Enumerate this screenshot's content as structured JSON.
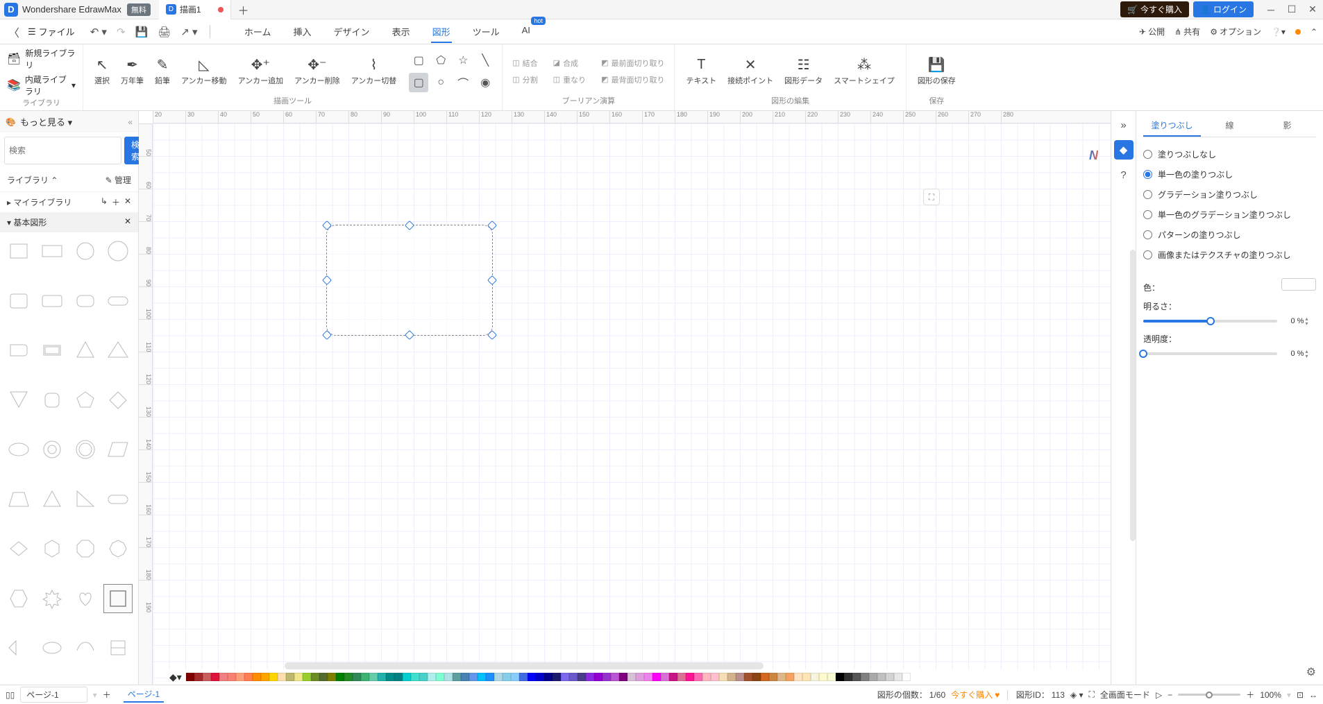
{
  "app": {
    "name": "Wondershare EdrawMax",
    "free_badge": "無料",
    "tab_title": "描画1"
  },
  "titlebar": {
    "buy_now": "今すぐ購入",
    "login": "ログイン"
  },
  "menubar": {
    "file": "ファイル",
    "tabs": [
      "ホーム",
      "挿入",
      "デザイン",
      "表示",
      "図形",
      "ツール",
      "AI"
    ],
    "active_tab": "図形",
    "hot": "hot",
    "publish": "公開",
    "share": "共有",
    "options": "オプション"
  },
  "ribbon": {
    "groups": {
      "library": {
        "label": "ライブラリ",
        "new": "新規ライブラリ",
        "builtin": "内蔵ライブラリ"
      },
      "drawing": {
        "label": "描画ツール",
        "select": "選択",
        "pen": "万年筆",
        "pencil": "鉛筆",
        "anchor_move": "アンカー移動",
        "anchor_add": "アンカー追加",
        "anchor_del": "アンカー削除",
        "anchor_cut": "アンカー切替"
      },
      "boolean": {
        "label": "ブーリアン演算",
        "combine": "結合",
        "compose": "合成",
        "front": "最前面切り取り",
        "split": "分割",
        "overlap": "重なり",
        "back": "最背面切り取り"
      },
      "edit": {
        "label": "図形の編集",
        "text": "テキスト",
        "connect": "接続ポイント",
        "data": "図形データ",
        "smart": "スマートシェイプ"
      },
      "save": {
        "label": "保存",
        "save": "図形の保存"
      }
    }
  },
  "sidebar": {
    "more": "もっと見る",
    "search_placeholder": "検索",
    "search_btn": "検索",
    "library": "ライブラリ",
    "manage": "管理",
    "mylibrary": "マイライブラリ",
    "basic_shapes": "基本図形"
  },
  "panel": {
    "tabs": {
      "fill": "塗りつぶし",
      "line": "線",
      "shadow": "影"
    },
    "fill_options": {
      "none": "塗りつぶしなし",
      "solid": "単一色の塗りつぶし",
      "gradient": "グラデーション塗りつぶし",
      "solid_grad": "単一色のグラデーション塗りつぶし",
      "pattern": "パターンの塗りつぶし",
      "texture": "画像またはテクスチャの塗りつぶし"
    },
    "color": "色：",
    "brightness": "明るさ：",
    "brightness_val": "0 %",
    "opacity": "透明度：",
    "opacity_val": "0 %"
  },
  "ruler": {
    "h": [
      "20",
      "30",
      "40",
      "50",
      "60",
      "70",
      "80",
      "90",
      "100",
      "110",
      "120",
      "130",
      "140",
      "150",
      "160",
      "170",
      "180",
      "190",
      "200",
      "210",
      "220",
      "230",
      "240",
      "250",
      "260",
      "270",
      "280"
    ],
    "v": [
      "50",
      "60",
      "70",
      "80",
      "90",
      "100",
      "110",
      "120",
      "130",
      "140",
      "150",
      "160",
      "170",
      "180",
      "190"
    ]
  },
  "colorbar": [
    "#800000",
    "#a52a2a",
    "#cd5c5c",
    "#dc143c",
    "#f08080",
    "#fa8072",
    "#ffa07a",
    "#ff7f50",
    "#ff8c00",
    "#ffa500",
    "#ffd700",
    "#ffdead",
    "#bdb76b",
    "#f0e68c",
    "#9acd32",
    "#6b8e23",
    "#556b2f",
    "#808000",
    "#008000",
    "#228b22",
    "#2e8b57",
    "#3cb371",
    "#66cdaa",
    "#20b2aa",
    "#008b8b",
    "#008080",
    "#00ced1",
    "#40e0d0",
    "#48d1cc",
    "#afeeee",
    "#7fffd4",
    "#b0e0e6",
    "#5f9ea0",
    "#4682b4",
    "#6495ed",
    "#00bfff",
    "#1e90ff",
    "#add8e6",
    "#87ceeb",
    "#87cefa",
    "#4169e1",
    "#0000ff",
    "#0000cd",
    "#00008b",
    "#191970",
    "#7b68ee",
    "#6a5acd",
    "#483d8b",
    "#8a2be2",
    "#9400d3",
    "#9932cc",
    "#ba55d3",
    "#800080",
    "#d8bfd8",
    "#dda0dd",
    "#ee82ee",
    "#ff00ff",
    "#da70d6",
    "#c71585",
    "#db7093",
    "#ff1493",
    "#ff69b4",
    "#ffb6c1",
    "#ffc0cb",
    "#f5deb3",
    "#d2b48c",
    "#bc8f8f",
    "#a0522d",
    "#8b4513",
    "#d2691e",
    "#cd853f",
    "#deb887",
    "#f4a460",
    "#ffe4c4",
    "#ffe4b5",
    "#f5f5dc",
    "#fffacd",
    "#fafad2",
    "#000000",
    "#2f2f2f",
    "#555555",
    "#808080",
    "#a9a9a9",
    "#c0c0c0",
    "#d3d3d3",
    "#e8e8e8",
    "#ffffff"
  ],
  "statusbar": {
    "page": "ページ-1",
    "page_tab": "ページ-1",
    "shape_count_label": "図形の個数：",
    "shape_count": "1/60",
    "buy": "今すぐ購入",
    "shape_id_label": "図形ID：",
    "shape_id": "113",
    "fullscreen": "全画面モード",
    "zoom": "100%"
  }
}
